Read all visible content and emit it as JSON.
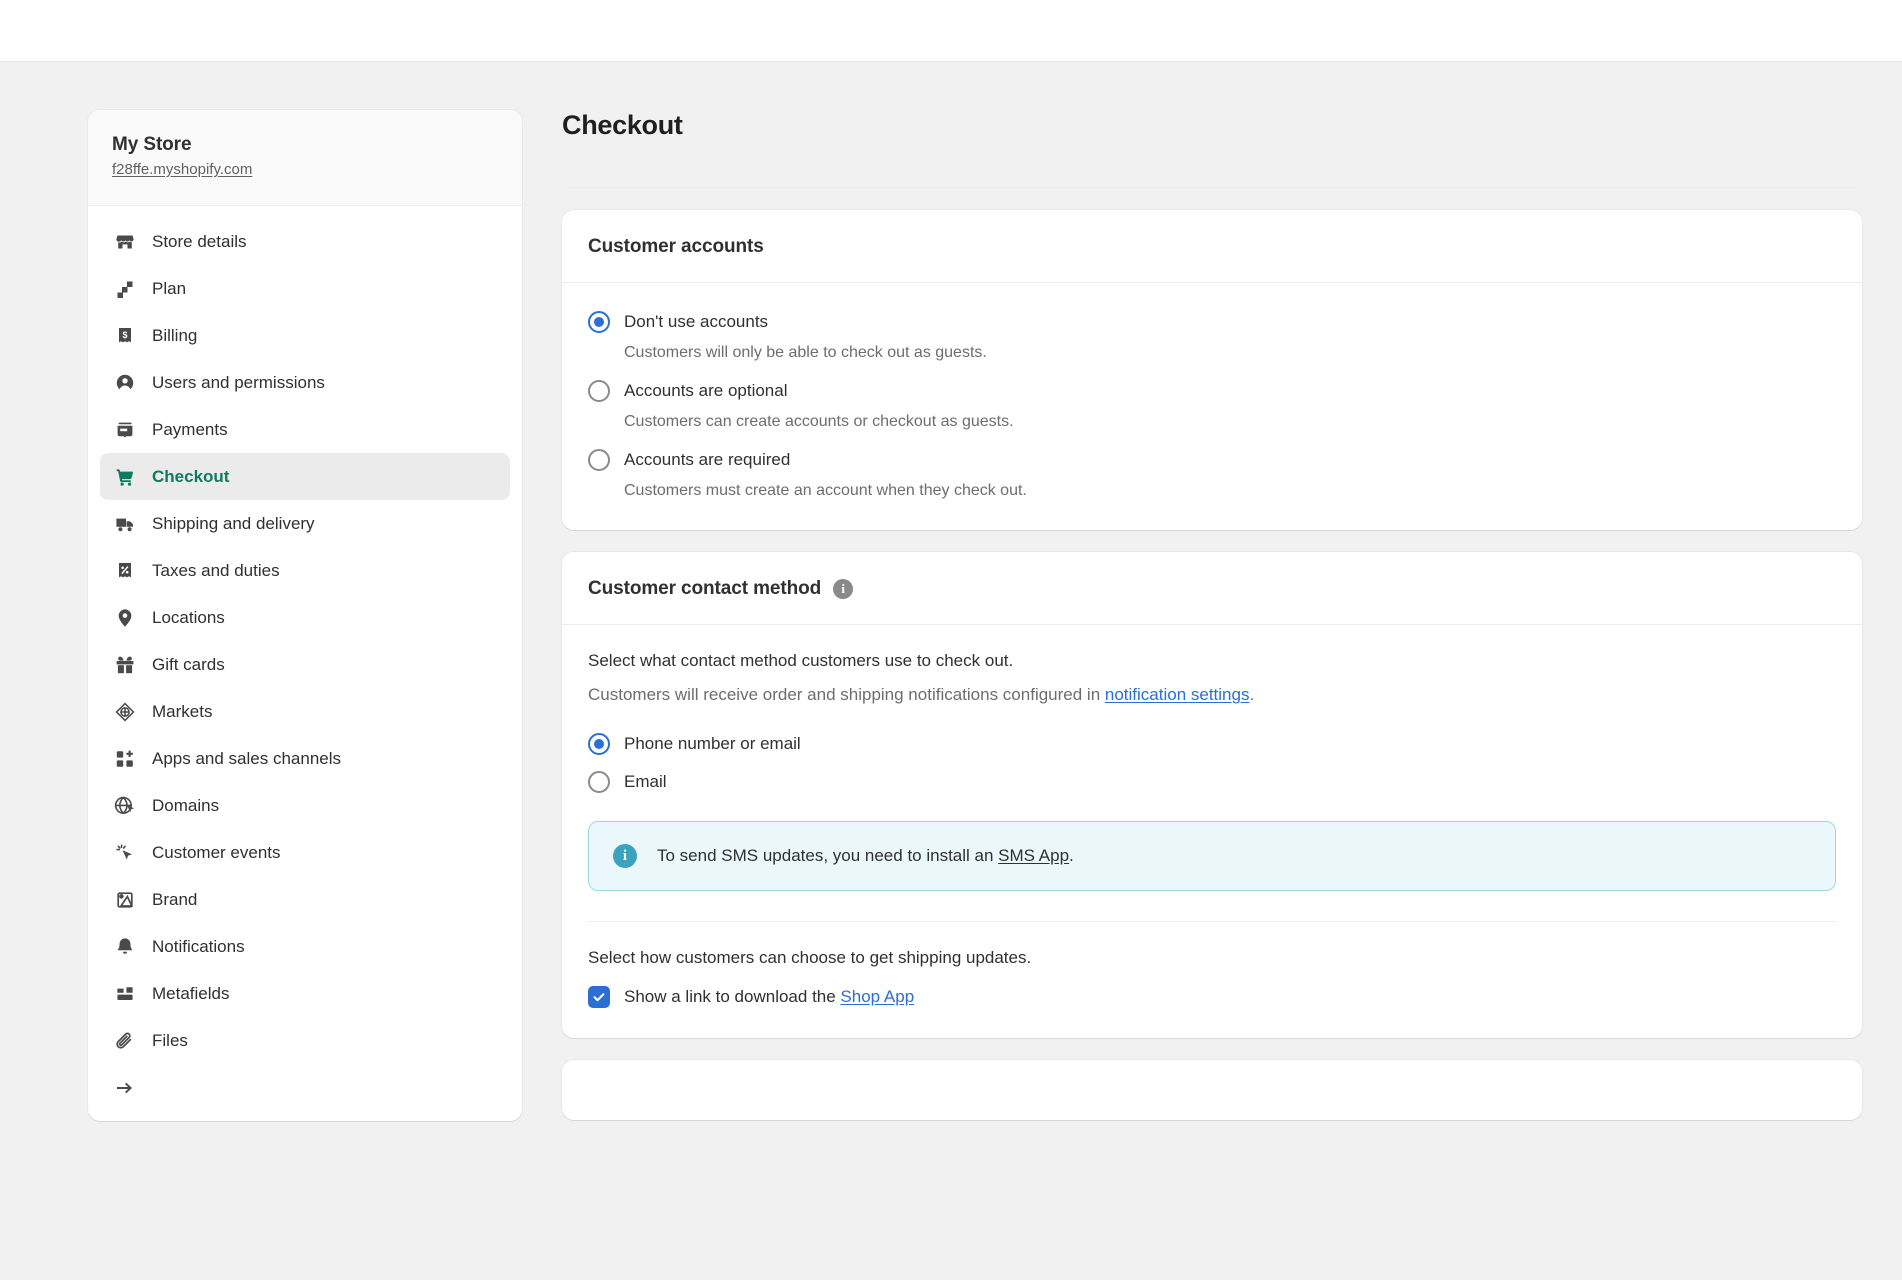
{
  "store": {
    "name": "My Store",
    "url": "f28ffe.myshopify.com"
  },
  "sidebar": {
    "items": [
      {
        "label": "Store details",
        "icon": "store-icon"
      },
      {
        "label": "Plan",
        "icon": "plan-icon"
      },
      {
        "label": "Billing",
        "icon": "billing-icon"
      },
      {
        "label": "Users and permissions",
        "icon": "user-icon"
      },
      {
        "label": "Payments",
        "icon": "payments-icon"
      },
      {
        "label": "Checkout",
        "icon": "cart-icon"
      },
      {
        "label": "Shipping and delivery",
        "icon": "truck-icon"
      },
      {
        "label": "Taxes and duties",
        "icon": "percent-receipt-icon"
      },
      {
        "label": "Locations",
        "icon": "map-pin-icon"
      },
      {
        "label": "Gift cards",
        "icon": "gift-icon"
      },
      {
        "label": "Markets",
        "icon": "globe-diamond-icon"
      },
      {
        "label": "Apps and sales channels",
        "icon": "apps-plus-icon"
      },
      {
        "label": "Domains",
        "icon": "globe-icon"
      },
      {
        "label": "Customer events",
        "icon": "cursor-click-icon"
      },
      {
        "label": "Brand",
        "icon": "brand-icon"
      },
      {
        "label": "Notifications",
        "icon": "bell-icon"
      },
      {
        "label": "Metafields",
        "icon": "metafields-icon"
      },
      {
        "label": "Files",
        "icon": "paperclip-icon"
      }
    ],
    "selected_label": "Checkout"
  },
  "main": {
    "page_title": "Checkout",
    "customer_accounts": {
      "title": "Customer accounts",
      "options": [
        {
          "label": "Don't use accounts",
          "help": "Customers will only be able to check out as guests.",
          "checked": true
        },
        {
          "label": "Accounts are optional",
          "help": "Customers can create accounts or checkout as guests.",
          "checked": false
        },
        {
          "label": "Accounts are required",
          "help": "Customers must create an account when they check out.",
          "checked": false
        }
      ]
    },
    "customer_contact_method": {
      "title": "Customer contact method",
      "info_icon": "info-icon",
      "intro": "Select what contact method customers use to check out.",
      "sub_prefix": "Customers will receive order and shipping notifications configured in ",
      "sub_link": "notification settings",
      "sub_suffix": ".",
      "options": [
        {
          "label": "Phone number or email",
          "checked": true
        },
        {
          "label": "Email",
          "checked": false
        }
      ],
      "banner": {
        "icon": "info-icon",
        "prefix": "To send SMS updates, you need to install an ",
        "link": "SMS App",
        "suffix": "."
      },
      "shipping_updates_text": "Select how customers can choose to get shipping updates.",
      "shop_app_checkbox": {
        "prefix": "Show a link to download the ",
        "link": "Shop App",
        "checked": true
      }
    }
  },
  "colors": {
    "accent_green": "#0f7a5f",
    "accent_blue": "#2b6fd4",
    "banner_bg": "#eaf7fb",
    "banner_border": "#9ed6e4",
    "banner_icon": "#3aa3bd",
    "page_bg": "#f1f1f1"
  }
}
